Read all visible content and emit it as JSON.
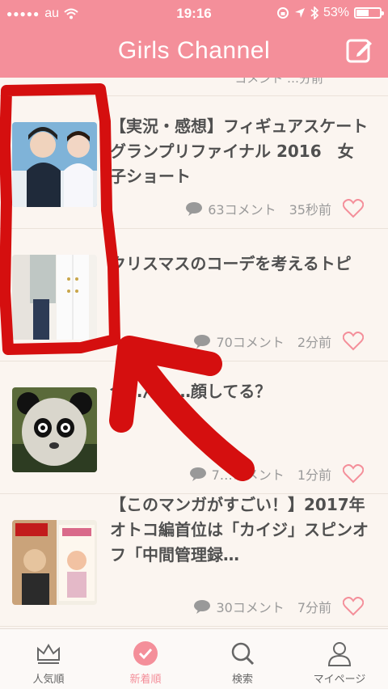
{
  "status_bar": {
    "carrier": "au",
    "time": "19:16",
    "battery": "53%",
    "battery_level": 0.53
  },
  "header": {
    "title": "Girls Channel",
    "compose_icon": "compose-icon"
  },
  "partial_item": {
    "meta": "コメント  …分前"
  },
  "topics": [
    {
      "title": "【実況・感想】フィギュアスケートグランプリファイナル 2016　女子ショート",
      "comments": "63コメント",
      "time": "35秒前"
    },
    {
      "title": "クリスマスのコーデを考えるトピ",
      "comments": "70コメント",
      "time": "2分前"
    },
    {
      "title": "今…んな…顔してる？",
      "comments": "7…コメント",
      "time": "1分前"
    },
    {
      "title": "【このマンガがすごい！】2017年オトコ編首位は「カイジ」スピンオフ「中間管理録…",
      "comments": "30コメント",
      "time": "7分前"
    }
  ],
  "tabs": [
    {
      "label": "人気順",
      "icon": "crown-icon"
    },
    {
      "label": "新着順",
      "icon": "check-icon"
    },
    {
      "label": "検索",
      "icon": "search-icon"
    },
    {
      "label": "マイページ",
      "icon": "person-icon"
    }
  ],
  "colors": {
    "brand": "#f48f9a",
    "background": "#fbf5f0",
    "annotation": "#d50f0f"
  }
}
